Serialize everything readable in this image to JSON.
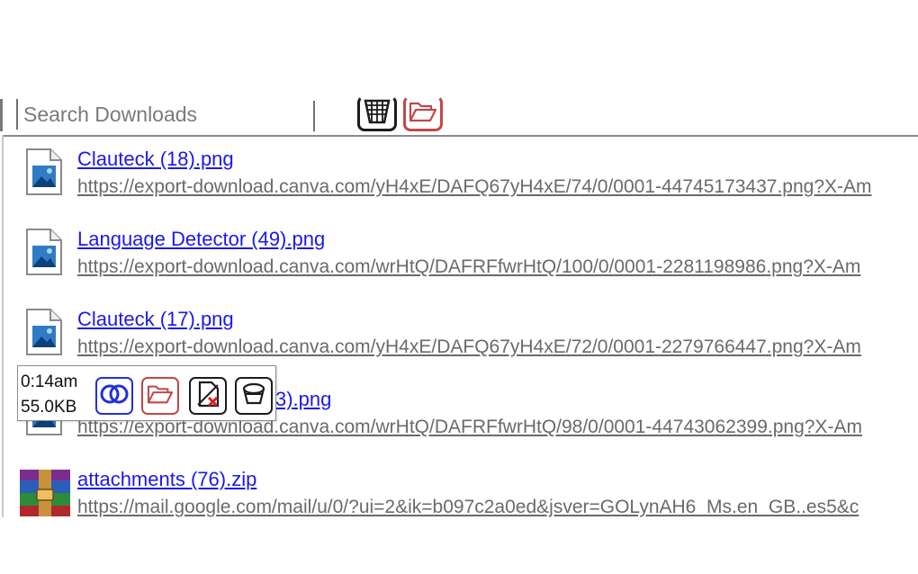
{
  "search": {
    "placeholder": "Search Downloads"
  },
  "toolbar": {
    "clear_icon": "clear-list-icon",
    "folder_icon": "open-folder-icon"
  },
  "downloads": [
    {
      "name": "Clauteck (18).png",
      "url": "https://export-download.canva.com/yH4xE/DAFQ67yH4xE/74/0/0001-44745173437.png?X-Am",
      "icon": "image-file-icon"
    },
    {
      "name": "Language Detector (49).png",
      "url": "https://export-download.canva.com/wrHtQ/DAFRFfwrHtQ/100/0/0001-2281198986.png?X-Am",
      "icon": "image-file-icon"
    },
    {
      "name": "Clauteck (17).png",
      "url": "https://export-download.canva.com/yH4xE/DAFQ67yH4xE/72/0/0001-2279766447.png?X-Am",
      "icon": "image-file-icon"
    },
    {
      "name": "3).png",
      "url": "https://export-download.canva.com/wrHtQ/DAFRFfwrHtQ/98/0/0001-44743062399.png?X-Am",
      "icon": "image-file-icon"
    },
    {
      "name": "attachments (76).zip",
      "url": "https://mail.google.com/mail/u/0/?ui=2&ik=b097c2a0ed&jsver=GOLynAH6_Ms.en_GB..es5&c",
      "icon": "archive-file-icon"
    }
  ],
  "popup": {
    "time": "0:14am",
    "size": "55.0KB",
    "buttons": [
      "open-file-icon",
      "show-in-folder-icon",
      "delete-file-icon",
      "remove-from-list-icon"
    ]
  },
  "colors": {
    "link": "#1a1aea",
    "url": "#6a6a6a",
    "folder_accent": "#c04848",
    "open_accent": "#2230d8"
  }
}
